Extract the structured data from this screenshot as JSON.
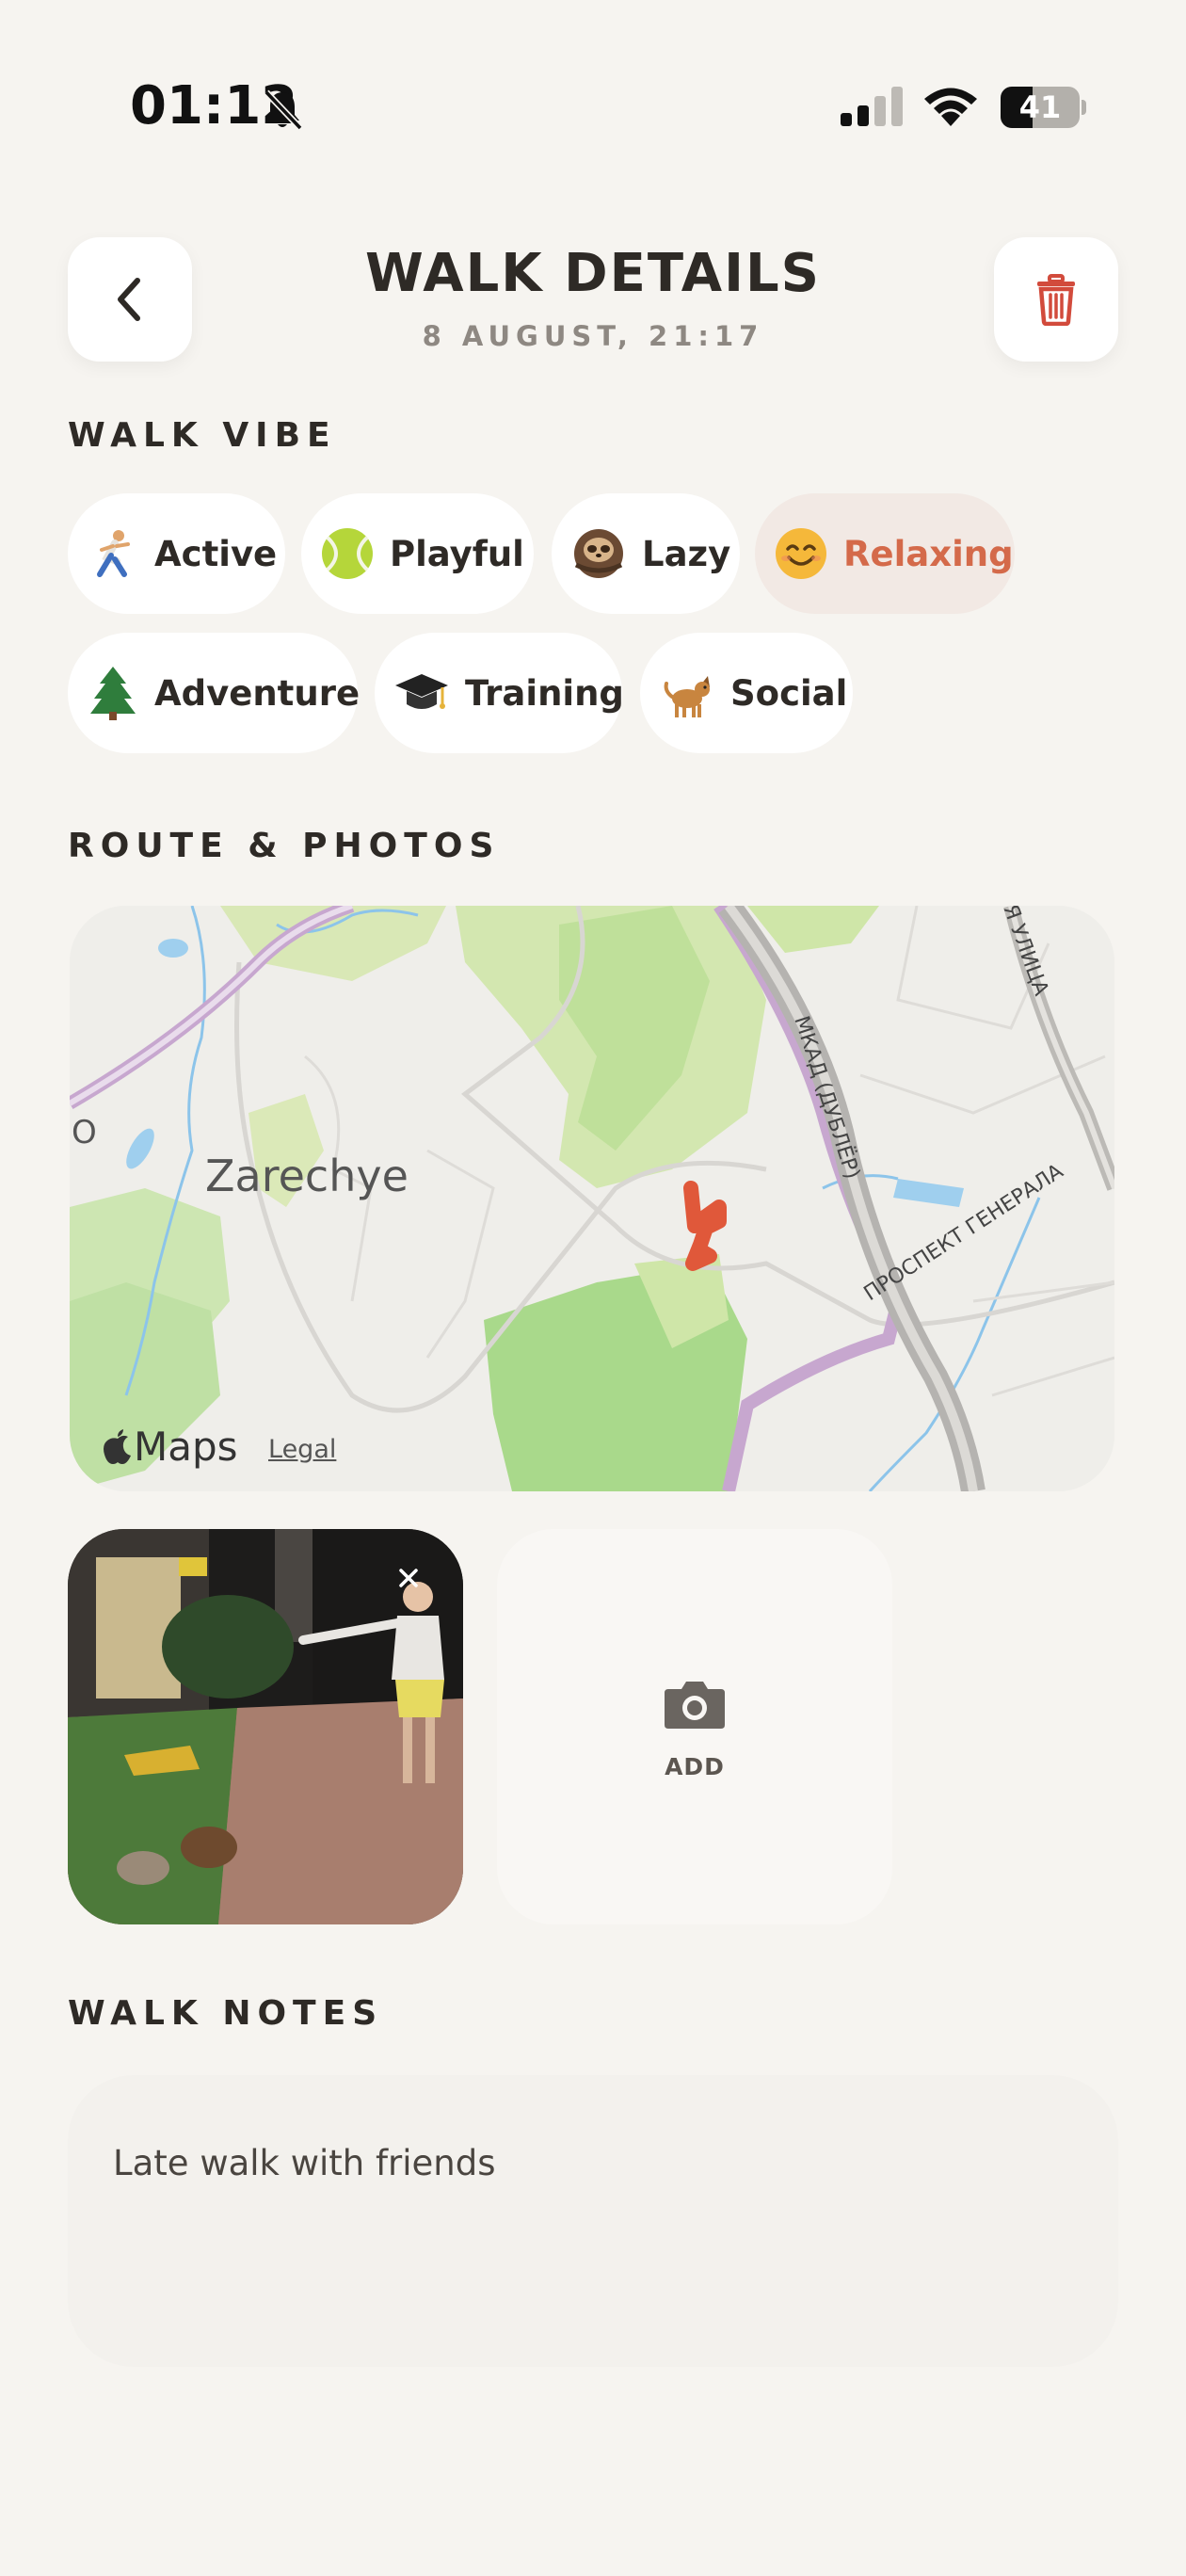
{
  "status_bar": {
    "time": "01:12",
    "battery": "41",
    "battery_level": 0.41
  },
  "header": {
    "title": "WALK DETAILS",
    "subtitle": "8 AUGUST, 21:17",
    "back_icon": "chevron-left-icon",
    "delete_icon": "trash-icon"
  },
  "vibe": {
    "label": "WALK VIBE",
    "chips": [
      {
        "emoji": "runner",
        "label": "Active",
        "selected": false
      },
      {
        "emoji": "tennis-ball",
        "label": "Playful",
        "selected": false
      },
      {
        "emoji": "sloth",
        "label": "Lazy",
        "selected": false
      },
      {
        "emoji": "smiling-face",
        "label": "Relaxing",
        "selected": true
      },
      {
        "emoji": "evergreen-tree",
        "label": "Adventure",
        "selected": false
      },
      {
        "emoji": "graduation-cap",
        "label": "Training",
        "selected": false
      },
      {
        "emoji": "dog",
        "label": "Social",
        "selected": false
      }
    ]
  },
  "route": {
    "label": "ROUTE & PHOTOS",
    "map": {
      "place_label": "Zarechye",
      "road_label_1": "МКАД (ДУБЛЁР)",
      "road_label_2": "ПРОСПЕКТ ГЕНЕРАЛА",
      "road_label_3": "Я УЛИЦА",
      "edge_label": "O",
      "attribution": "Maps",
      "legal": "Legal"
    },
    "photos": {
      "add_label": "ADD"
    }
  },
  "notes": {
    "label": "WALK NOTES",
    "text": "Late walk with friends"
  },
  "colors": {
    "accent": "#d46a4a",
    "route": "#e0583a",
    "background": "#f6f4f0"
  }
}
